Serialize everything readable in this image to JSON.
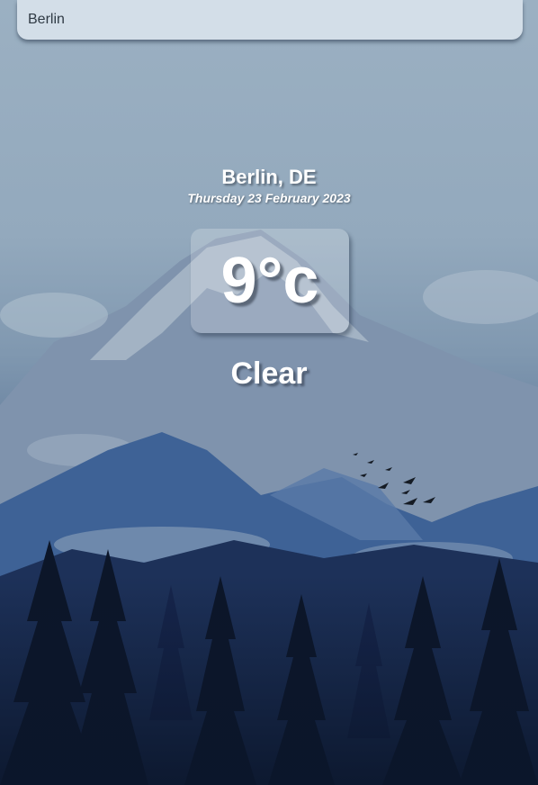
{
  "search": {
    "value": "Berlin"
  },
  "weather": {
    "location": "Berlin, DE",
    "date": "Thursday 23 February 2023",
    "temperature": "9°c",
    "condition": "Clear"
  },
  "colors": {
    "sky_top": "#9bb0c2",
    "mountain_near": "#3a5f96",
    "forest": "#0f1d36",
    "text": "#ffffff"
  }
}
